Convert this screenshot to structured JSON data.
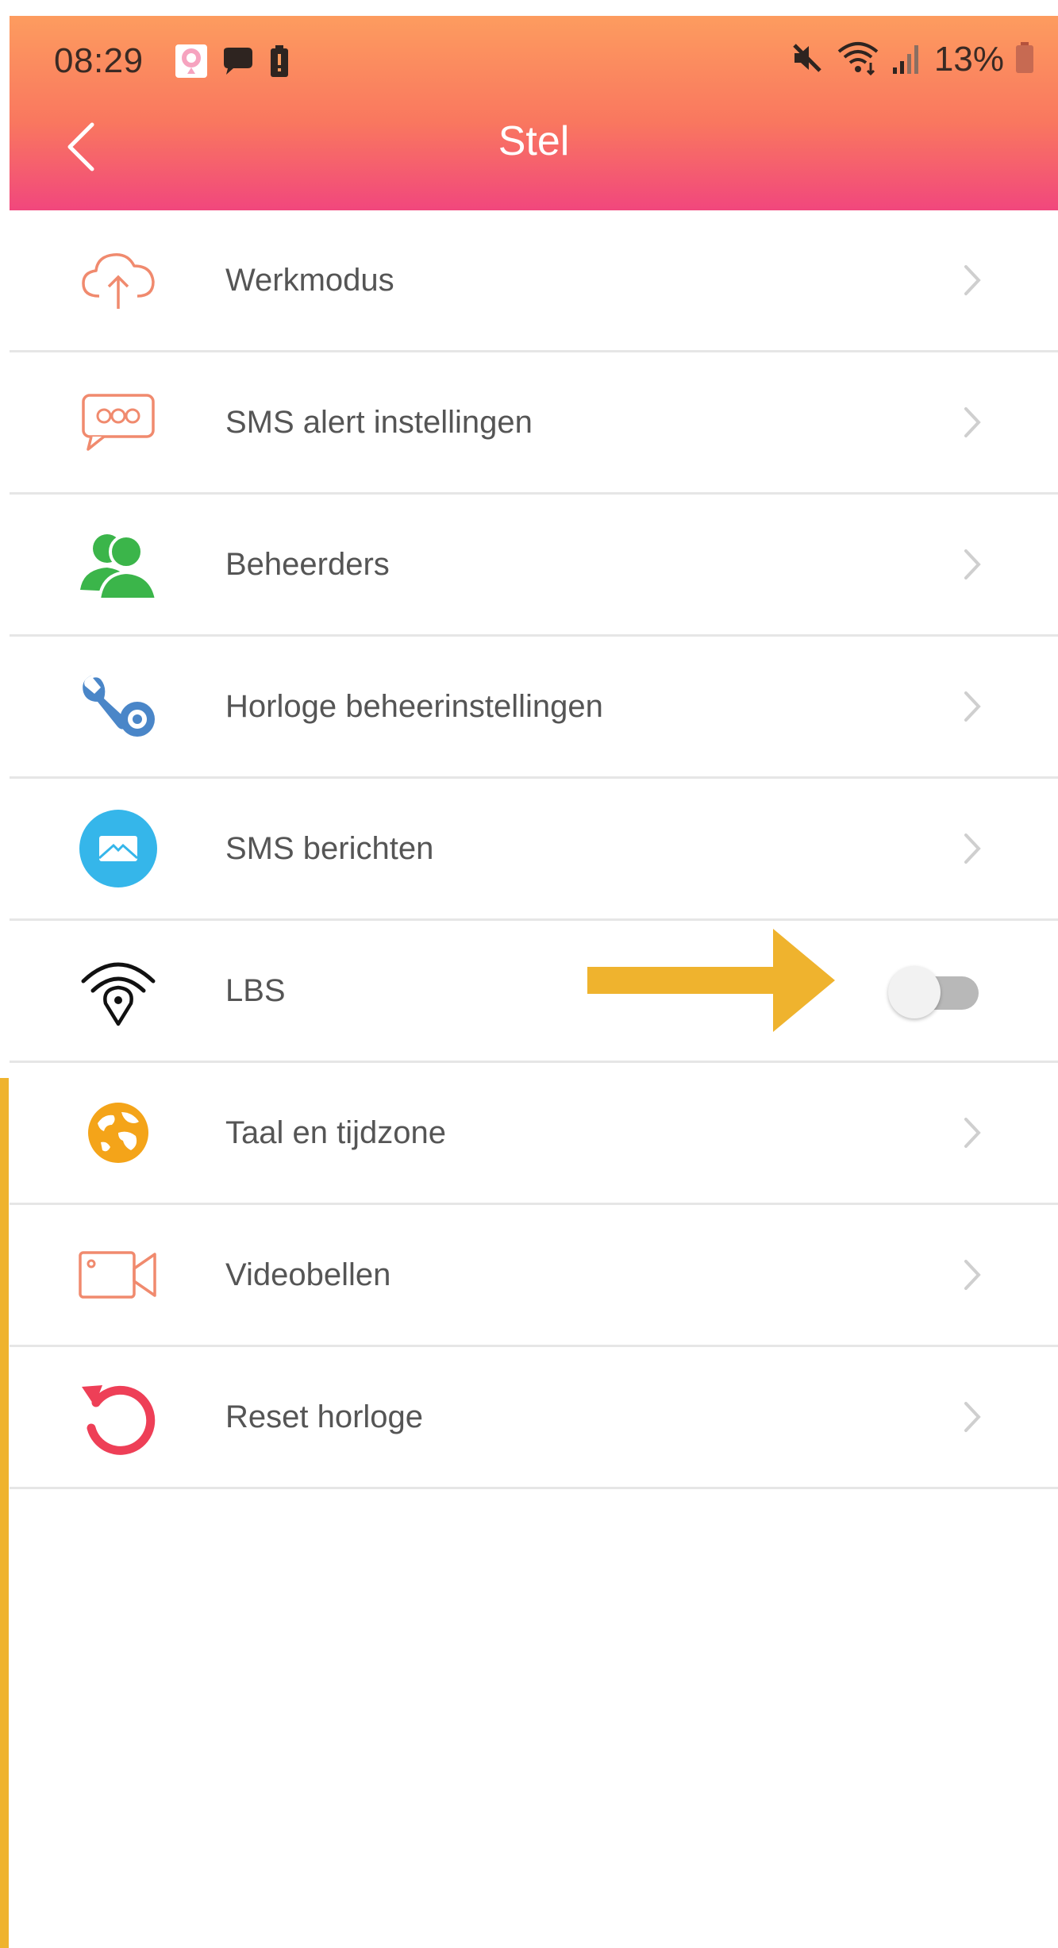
{
  "status_bar": {
    "time": "08:29",
    "battery_percent": "13%",
    "notification_icons": [
      "app-icon",
      "chat-bubble-icon",
      "battery-alert-icon"
    ],
    "system_icons": [
      "mute-icon",
      "wifi-icon",
      "signal-icon",
      "battery-icon"
    ]
  },
  "header": {
    "title": "Stel",
    "back_icon": "back-arrow-icon",
    "gradient_colors": [
      "#fd9c5f",
      "#f1477d"
    ]
  },
  "settings": {
    "items": [
      {
        "label": "Werkmodus",
        "icon": "cloud-upload-icon",
        "type": "link"
      },
      {
        "label": "SMS alert instellingen",
        "icon": "sms-alert-icon",
        "type": "link"
      },
      {
        "label": "Beheerders",
        "icon": "admins-icon",
        "type": "link"
      },
      {
        "label": "Horloge beheerinstellingen",
        "icon": "watch-tools-icon",
        "type": "link"
      },
      {
        "label": "SMS berichten",
        "icon": "message-icon",
        "type": "link"
      },
      {
        "label": "LBS",
        "icon": "location-signal-icon",
        "type": "toggle",
        "toggle_on": false
      },
      {
        "label": "Taal en tijdzone",
        "icon": "globe-icon",
        "type": "link"
      },
      {
        "label": "Videobellen",
        "icon": "video-call-icon",
        "type": "link"
      },
      {
        "label": "Reset horloge",
        "icon": "reset-icon",
        "type": "link"
      }
    ]
  },
  "annotation": {
    "color": "#efb32e"
  }
}
